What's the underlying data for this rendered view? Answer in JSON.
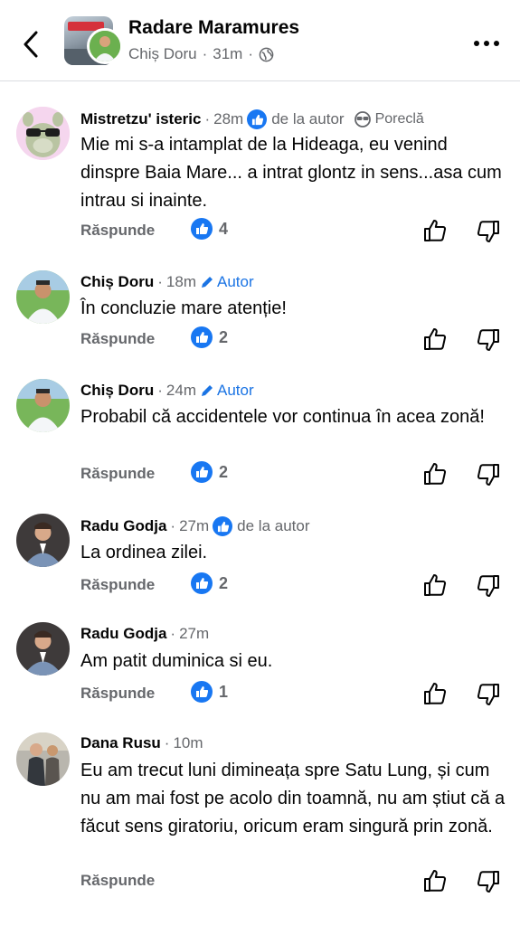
{
  "header": {
    "group_name": "Radare Maramures",
    "author": "Chiș Doru",
    "time": "31m",
    "separator": "·"
  },
  "comments": [
    {
      "name": "Mistretzu' isteric",
      "time": "28m",
      "liked_by_author_label": "de la autor",
      "nickname_label": "Poreclă",
      "text": "Mie mi s-a intamplat de la Hideaga, eu venind dinspre Baia Mare... a intrat glontz in sens...asa cum intrau si inainte.",
      "reply_label": "Răspunde",
      "likes": "4"
    },
    {
      "name": "Chiș Doru",
      "time": "18m",
      "author_label": "Autor",
      "text": "În concluzie mare atenție!",
      "reply_label": "Răspunde",
      "likes": "2"
    },
    {
      "name": "Chiș Doru",
      "time": "24m",
      "author_label": "Autor",
      "text": "Probabil că accidentele vor continua în acea zonă!",
      "reply_label": "Răspunde",
      "likes": "2"
    },
    {
      "name": "Radu Godja",
      "time": "27m",
      "liked_by_author_label": "de la autor",
      "text": "La ordinea zilei.",
      "reply_label": "Răspunde",
      "likes": "2"
    },
    {
      "name": "Radu Godja",
      "time": "27m",
      "text": "Am patit duminica si eu.",
      "reply_label": "Răspunde",
      "likes": "1"
    },
    {
      "name": "Dana Rusu",
      "time": "10m",
      "text": "Eu am trecut luni dimineața spre Satu Lung, și cum nu am mai fost pe acolo din toamnă, nu am știut că a făcut sens giratoriu, oricum eram singură prin zonă.",
      "reply_label": "Răspunde"
    }
  ],
  "colors": {
    "accent_blue": "#1877f2",
    "secondary_text": "#65676b",
    "primary_text": "#050505"
  },
  "icons": [
    "back-arrow-icon",
    "globe-icon",
    "more-dots-icon",
    "like-icon",
    "pencil-icon",
    "sunglasses-icon",
    "thumb-up-icon",
    "thumb-down-icon"
  ]
}
